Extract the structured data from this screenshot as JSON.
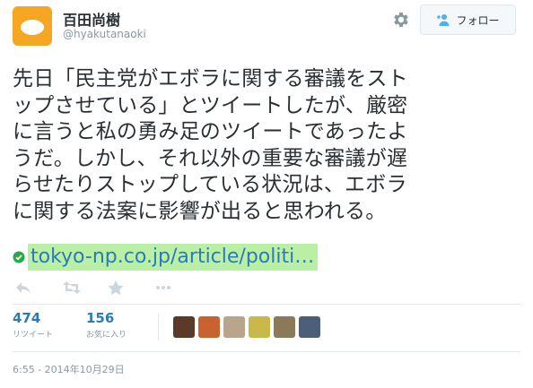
{
  "author": {
    "display_name": "百田尚樹",
    "handle": "@hyakutanaoki"
  },
  "follow_button": {
    "label": "フォロー"
  },
  "tweet": {
    "lines": [
      "先日「民主党がエボラに関する審議をスト",
      "ップさせている」とツイートしたが、厳密",
      "に言うと私の勇み足のツイートであったよ",
      "うだ。しかし、それ以外の重要な審議が遅",
      "らせたりストップしている状況は、エボラ",
      "に関する法案に影響が出ると思われる。"
    ],
    "link": "tokyo-np.co.jp/article/politi…"
  },
  "stats": {
    "retweets": {
      "count": "474",
      "label": "リツイート"
    },
    "favorites": {
      "count": "156",
      "label": "お気に入り"
    }
  },
  "engager_avatar_colors": [
    "#5a3b2a",
    "#c8632f",
    "#b9a48c",
    "#c9b84a",
    "#8a7a5a",
    "#4b6078"
  ],
  "timestamp": "6:55 - 2014年10月29日",
  "colors": {
    "accent": "#55acee",
    "link": "#2b7bb9",
    "link_highlight": "#b9f0a6",
    "avatar_bg": "#f5a623",
    "muted": "#8899a6"
  },
  "icons": [
    "gear-icon",
    "follow-person-icon",
    "verified-check-icon",
    "reply-icon",
    "retweet-icon",
    "favorite-star-icon",
    "more-icon"
  ]
}
